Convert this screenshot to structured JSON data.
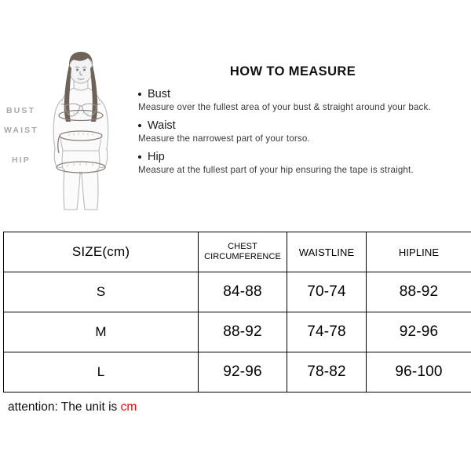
{
  "figure": {
    "labels": [
      {
        "name": "bust",
        "text": "BUST"
      },
      {
        "name": "waist",
        "text": "WAIST"
      },
      {
        "name": "hip",
        "text": "HIP"
      }
    ],
    "illustration_alt": "female-body-measurement-diagram"
  },
  "instructions": {
    "title": "HOW TO MEASURE",
    "items": [
      {
        "heading": "Bust",
        "description": "Measure over the fullest area of your bust & straight around your back."
      },
      {
        "heading": "Waist",
        "description": "Measure the narrowest part of your torso."
      },
      {
        "heading": "Hip",
        "description": "Measure at the fullest part of your hip ensuring the tape is straight."
      }
    ]
  },
  "size_table": {
    "headers": {
      "size": "SIZE(cm)",
      "chest_line1": "CHEST",
      "chest_line2": "CIRCUMFERENCE",
      "waist": "WAISTLINE",
      "hip": "HIPLINE"
    },
    "rows": [
      {
        "size": "S",
        "chest": "84-88",
        "waist": "70-74",
        "hip": "88-92"
      },
      {
        "size": "M",
        "chest": "88-92",
        "waist": "74-78",
        "hip": "92-96"
      },
      {
        "size": "L",
        "chest": "92-96",
        "waist": "78-82",
        "hip": "96-100"
      }
    ]
  },
  "attention": {
    "prefix": "attention:  The unit is ",
    "unit": "cm",
    "unit_color": "#ff0000"
  },
  "colors": {
    "background": "#ffffff",
    "text": "#000000",
    "label_gray": "#a8a8a8",
    "table_border": "#000000",
    "accent_red": "#ff0000"
  }
}
